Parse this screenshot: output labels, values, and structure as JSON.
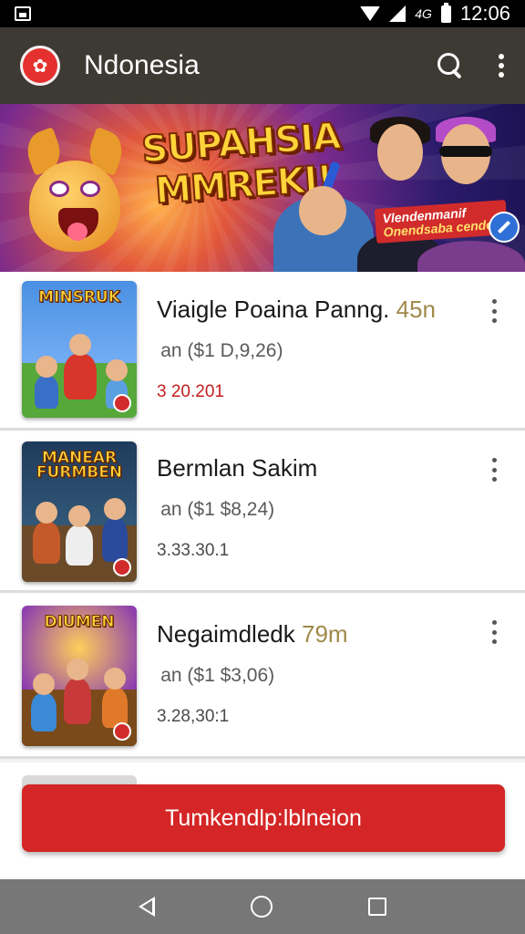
{
  "status_bar": {
    "network_label": "4G",
    "time": "12:06"
  },
  "app_bar": {
    "title": "Ndonesia"
  },
  "banner": {
    "title_line1": "SUPAHSIA",
    "title_line2": "MMREKI!",
    "tag_line1": "Vlendenmanif",
    "tag_line2": "Onendsaba cendec"
  },
  "thumbnails": {
    "t1_title": "MINSRUK",
    "t2_title": "MANEAR FURMBEN",
    "t3_title": "DIUMEN"
  },
  "items": [
    {
      "name": "Viaigle Poaina Panng.",
      "size": "45n",
      "meta": " an ($1 D,9,26)",
      "date": "3 20.201",
      "date_color": "#c41d1d"
    },
    {
      "name": "Bermlan Sakim",
      "size": "",
      "meta": " an ($1 $8,24)",
      "date": "3.33.30.1",
      "date_color": "#4a4a4a"
    },
    {
      "name": "Negaimdledk",
      "size": "79m",
      "meta": " an ($1 $3,06)",
      "date": "3.28,30:1",
      "date_color": "#4a4a4a"
    }
  ],
  "cta": {
    "label": "Tumkendlp:lblneion"
  }
}
